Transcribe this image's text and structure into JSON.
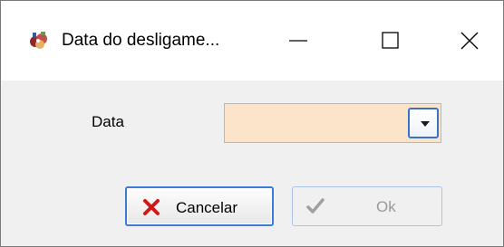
{
  "window": {
    "title": "Data do desligame..."
  },
  "form": {
    "date_label": "Data",
    "date_value": ""
  },
  "buttons": {
    "cancel_label": "Cancelar",
    "ok_label": "Ok",
    "ok_enabled": false
  },
  "icons": {
    "app": "app-logo-icon",
    "minimize": "minimize-icon",
    "maximize": "maximize-icon",
    "close": "close-icon",
    "dropdown": "chevron-down-icon",
    "cancel": "x-icon",
    "ok": "checkmark-icon"
  },
  "colors": {
    "combo_background": "#fce4cb",
    "focus_border": "#3a7bd5",
    "cancel_icon": "#d01818",
    "disabled_text": "#9a9a9a"
  }
}
